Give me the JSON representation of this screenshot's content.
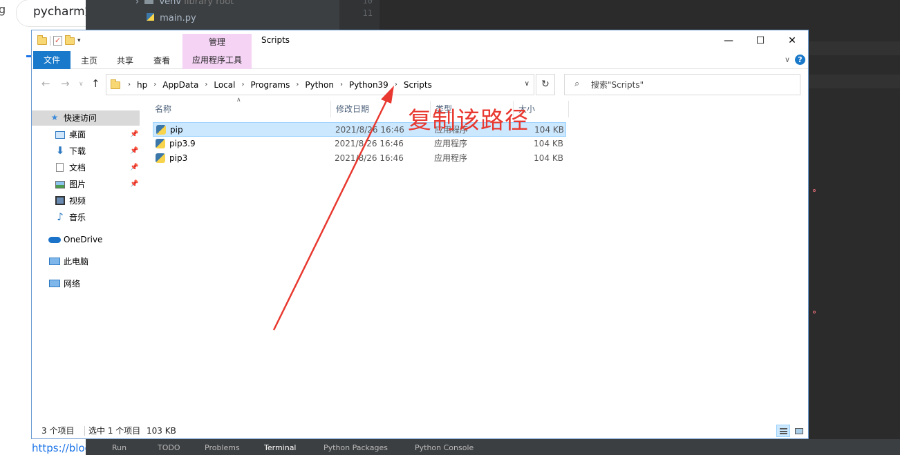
{
  "background": {
    "browser_tab_title": "pycharm如",
    "browser_letter": "g",
    "browser_link": "https://blog",
    "pycharm": {
      "folder_name": "venv",
      "folder_note": "library root",
      "file_name": "main.py",
      "line_numbers": [
        "10",
        "11"
      ],
      "bottom_tabs": [
        "Run",
        "TODO",
        "Problems",
        "Terminal",
        "Python Packages",
        "Python Console"
      ]
    }
  },
  "window": {
    "title": "Scripts",
    "manage_tab": "管理",
    "controls": {
      "minimize": "—",
      "maximize": "☐",
      "close": "✕"
    }
  },
  "ribbon": {
    "tabs": [
      "文件",
      "主页",
      "共享",
      "查看"
    ],
    "app_tools": "应用程序工具",
    "help": "?"
  },
  "address": {
    "crumbs": [
      "hp",
      "AppData",
      "Local",
      "Programs",
      "Python",
      "Python39",
      "Scripts"
    ]
  },
  "search": {
    "placeholder": "搜索\"Scripts\""
  },
  "sidebar": {
    "items": [
      {
        "label": "快速访问",
        "icon": "star-icon"
      },
      {
        "label": "桌面",
        "icon": "desktop-icon"
      },
      {
        "label": "下载",
        "icon": "download-icon"
      },
      {
        "label": "文档",
        "icon": "document-icon"
      },
      {
        "label": "图片",
        "icon": "picture-icon"
      },
      {
        "label": "视频",
        "icon": "video-icon"
      },
      {
        "label": "音乐",
        "icon": "music-icon"
      },
      {
        "label": "OneDrive",
        "icon": "cloud-icon"
      },
      {
        "label": "此电脑",
        "icon": "computer-icon"
      },
      {
        "label": "网络",
        "icon": "network-icon"
      }
    ]
  },
  "columns": {
    "name": "名称",
    "date": "修改日期",
    "type": "类型",
    "size": "大小"
  },
  "files": [
    {
      "name": "pip",
      "date": "2021/8/26 16:46",
      "type": "应用程序",
      "size": "104 KB"
    },
    {
      "name": "pip3.9",
      "date": "2021/8/26 16:46",
      "type": "应用程序",
      "size": "104 KB"
    },
    {
      "name": "pip3",
      "date": "2021/8/26 16:46",
      "type": "应用程序",
      "size": "104 KB"
    }
  ],
  "status": {
    "count": "3 个项目",
    "selected": "选中 1 个项目",
    "size": "103 KB"
  },
  "annotation": {
    "text": "复制该路径",
    "color": "#e8382f"
  },
  "colors": {
    "accent": "#1979ca",
    "selection": "#cce8ff",
    "manage_tab": "#f4d3f4"
  }
}
